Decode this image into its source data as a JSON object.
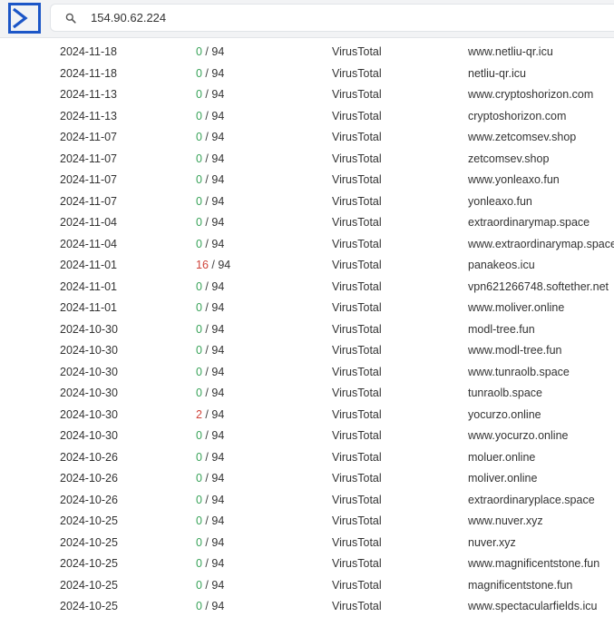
{
  "header": {
    "search_value": "154.90.62.224",
    "colors": {
      "logo": "#1c56c7",
      "clean": "#3aa35a",
      "malicious": "#d0443a"
    },
    "icons": {
      "logo": "sigma-logo-icon",
      "search": "search-icon"
    }
  },
  "resolutions": [
    {
      "date": "2024-11-18",
      "positives": "0",
      "total": "94",
      "source": "VirusTotal",
      "domain": "www.netliu-qr.icu"
    },
    {
      "date": "2024-11-18",
      "positives": "0",
      "total": "94",
      "source": "VirusTotal",
      "domain": "netliu-qr.icu"
    },
    {
      "date": "2024-11-13",
      "positives": "0",
      "total": "94",
      "source": "VirusTotal",
      "domain": "www.cryptoshorizon.com"
    },
    {
      "date": "2024-11-13",
      "positives": "0",
      "total": "94",
      "source": "VirusTotal",
      "domain": "cryptoshorizon.com"
    },
    {
      "date": "2024-11-07",
      "positives": "0",
      "total": "94",
      "source": "VirusTotal",
      "domain": "www.zetcomsev.shop"
    },
    {
      "date": "2024-11-07",
      "positives": "0",
      "total": "94",
      "source": "VirusTotal",
      "domain": "zetcomsev.shop"
    },
    {
      "date": "2024-11-07",
      "positives": "0",
      "total": "94",
      "source": "VirusTotal",
      "domain": "www.yonleaxo.fun"
    },
    {
      "date": "2024-11-07",
      "positives": "0",
      "total": "94",
      "source": "VirusTotal",
      "domain": "yonleaxo.fun"
    },
    {
      "date": "2024-11-04",
      "positives": "0",
      "total": "94",
      "source": "VirusTotal",
      "domain": "extraordinarymap.space"
    },
    {
      "date": "2024-11-04",
      "positives": "0",
      "total": "94",
      "source": "VirusTotal",
      "domain": "www.extraordinarymap.space"
    },
    {
      "date": "2024-11-01",
      "positives": "16",
      "total": "94",
      "source": "VirusTotal",
      "domain": "panakeos.icu"
    },
    {
      "date": "2024-11-01",
      "positives": "0",
      "total": "94",
      "source": "VirusTotal",
      "domain": "vpn621266748.softether.net"
    },
    {
      "date": "2024-11-01",
      "positives": "0",
      "total": "94",
      "source": "VirusTotal",
      "domain": "www.moliver.online"
    },
    {
      "date": "2024-10-30",
      "positives": "0",
      "total": "94",
      "source": "VirusTotal",
      "domain": "modl-tree.fun"
    },
    {
      "date": "2024-10-30",
      "positives": "0",
      "total": "94",
      "source": "VirusTotal",
      "domain": "www.modl-tree.fun"
    },
    {
      "date": "2024-10-30",
      "positives": "0",
      "total": "94",
      "source": "VirusTotal",
      "domain": "www.tunraolb.space"
    },
    {
      "date": "2024-10-30",
      "positives": "0",
      "total": "94",
      "source": "VirusTotal",
      "domain": "tunraolb.space"
    },
    {
      "date": "2024-10-30",
      "positives": "2",
      "total": "94",
      "source": "VirusTotal",
      "domain": "yocurzo.online"
    },
    {
      "date": "2024-10-30",
      "positives": "0",
      "total": "94",
      "source": "VirusTotal",
      "domain": "www.yocurzo.online"
    },
    {
      "date": "2024-10-26",
      "positives": "0",
      "total": "94",
      "source": "VirusTotal",
      "domain": "moluer.online"
    },
    {
      "date": "2024-10-26",
      "positives": "0",
      "total": "94",
      "source": "VirusTotal",
      "domain": "moliver.online"
    },
    {
      "date": "2024-10-26",
      "positives": "0",
      "total": "94",
      "source": "VirusTotal",
      "domain": "extraordinaryplace.space"
    },
    {
      "date": "2024-10-25",
      "positives": "0",
      "total": "94",
      "source": "VirusTotal",
      "domain": "www.nuver.xyz"
    },
    {
      "date": "2024-10-25",
      "positives": "0",
      "total": "94",
      "source": "VirusTotal",
      "domain": "nuver.xyz"
    },
    {
      "date": "2024-10-25",
      "positives": "0",
      "total": "94",
      "source": "VirusTotal",
      "domain": "www.magnificentstone.fun"
    },
    {
      "date": "2024-10-25",
      "positives": "0",
      "total": "94",
      "source": "VirusTotal",
      "domain": "magnificentstone.fun"
    },
    {
      "date": "2024-10-25",
      "positives": "0",
      "total": "94",
      "source": "VirusTotal",
      "domain": "www.spectacularfields.icu"
    }
  ]
}
